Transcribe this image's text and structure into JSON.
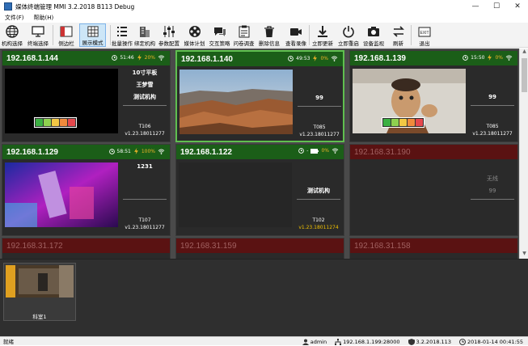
{
  "window": {
    "title": "媒体终端管理 MMI 3.2.2018 B113 Debug"
  },
  "menu": [
    "文件(F)",
    "帮助(H)"
  ],
  "toolbar": [
    {
      "label": "机构选择",
      "icon": "globe-icon"
    },
    {
      "label": "终端选择",
      "icon": "monitor-icon"
    },
    {
      "label": "侧边栏",
      "icon": "sidebar-icon"
    },
    {
      "label": "展示模式",
      "icon": "grid-icon"
    },
    {
      "label": "批量操作",
      "icon": "list-icon"
    },
    {
      "label": "绑定机构",
      "icon": "building-icon"
    },
    {
      "label": "参数配置",
      "icon": "sliders-icon"
    },
    {
      "label": "媒体计划",
      "icon": "film-reel-icon"
    },
    {
      "label": "交互策略",
      "icon": "chat-icon"
    },
    {
      "label": "问卷调查",
      "icon": "clipboard-icon"
    },
    {
      "label": "删除信息",
      "icon": "trash-icon"
    },
    {
      "label": "查看录像",
      "icon": "camera-icon"
    },
    {
      "label": "立即更新",
      "icon": "download-icon"
    },
    {
      "label": "立即重启",
      "icon": "power-icon"
    },
    {
      "label": "设备监视",
      "icon": "photo-camera-icon"
    },
    {
      "label": "刷新",
      "icon": "refresh-icon"
    },
    {
      "label": "退出",
      "icon": "exit-icon",
      "badge": "EXIT"
    }
  ],
  "terminals": [
    {
      "ip": "192.168.1.144",
      "time": "51:46",
      "battery": "20%",
      "online": true,
      "lines": [
        "10寸平板",
        "王梦雪",
        "测试机构"
      ],
      "tid": "T106",
      "ver": "v1.23.18011277",
      "thumb": "black",
      "emo": true
    },
    {
      "ip": "192.168.1.140",
      "time": "49:53",
      "battery": "0%",
      "online": true,
      "lines": [
        "",
        "",
        "99"
      ],
      "tid": "T085",
      "ver": "v1.23.18011277",
      "thumb": "canyon",
      "selected": true
    },
    {
      "ip": "192.168.1.139",
      "time": "15:50",
      "battery": "0%",
      "online": true,
      "lines": [
        "",
        "",
        "99"
      ],
      "tid": "T085",
      "ver": "v1.23.18011277",
      "thumb": "man",
      "emo": true
    },
    {
      "ip": "192.168.1.129",
      "time": "58:51",
      "battery": "100%",
      "online": true,
      "lines": [
        "1231",
        "",
        ""
      ],
      "tid": "T107",
      "ver": "v1.23.18011277",
      "thumb": "neon"
    },
    {
      "ip": "192.168.1.122",
      "time": "-",
      "battery": "0%",
      "online": true,
      "lines": [
        "",
        "",
        "测试机构"
      ],
      "tid": "T102",
      "ver": "v1.23.18011274",
      "thumb": "dark",
      "warn": true
    },
    {
      "ip": "192.168.31.190",
      "time": "",
      "battery": "",
      "online": false,
      "lines": [
        "",
        "无线",
        "99"
      ],
      "tid": "",
      "ver": "",
      "thumb": "none"
    },
    {
      "ip": "192.168.31.172",
      "online": false,
      "partial": true
    },
    {
      "ip": "192.168.31.159",
      "online": false,
      "partial": true
    },
    {
      "ip": "192.168.31.158",
      "online": false,
      "partial": true
    }
  ],
  "emo_colors": [
    "#3cb043",
    "#8fd14f",
    "#f2c744",
    "#f08a3c",
    "#e5484d"
  ],
  "bottom": {
    "caption": "科室1"
  },
  "status": {
    "ready": "就绪",
    "user": "admin",
    "server": "192.168.1.199:28000",
    "version": "3.2.2018.113",
    "datetime": "2018-01-14 00:41:55"
  },
  "colors": {
    "online_header": "#1b5e18",
    "offline_header": "#5a1212",
    "selected_border": "#5fbf4f"
  }
}
